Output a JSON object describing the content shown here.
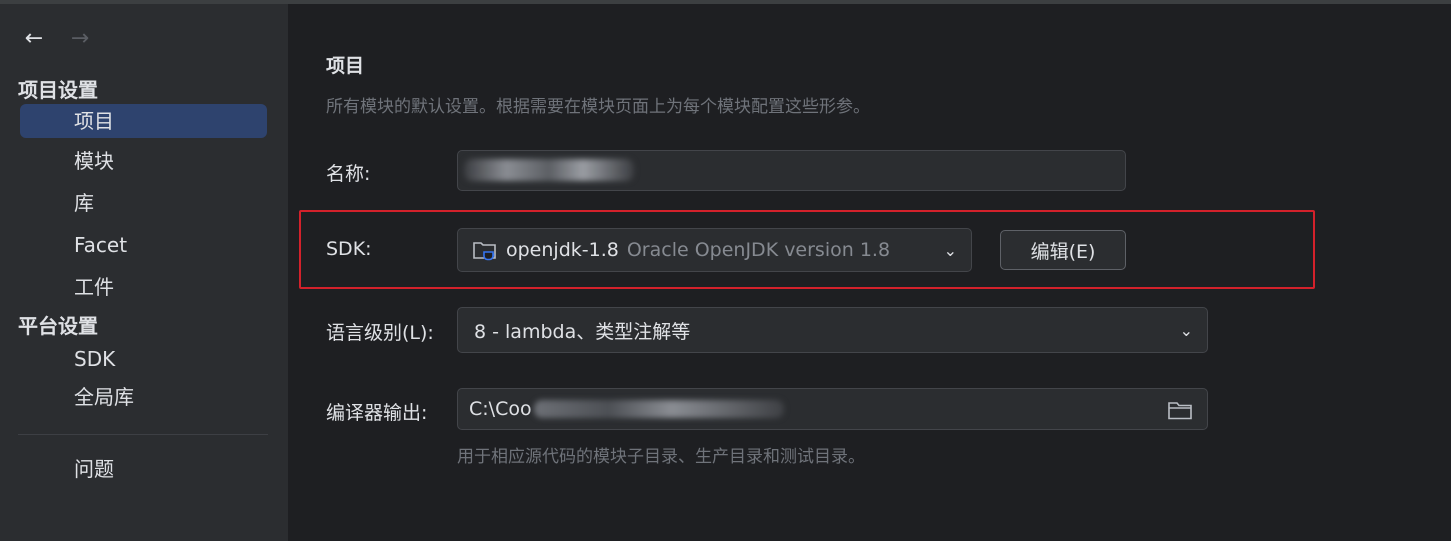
{
  "sidebar": {
    "nav": {
      "back_icon": "←",
      "forward_icon": "→"
    },
    "section_project_settings": "项目设置",
    "project_items": [
      "项目",
      "模块",
      "库",
      "Facet",
      "工件"
    ],
    "section_platform_settings": "平台设置",
    "platform_items": [
      "SDK",
      "全局库"
    ],
    "problems": "问题",
    "selected_item": "项目"
  },
  "main": {
    "title": "项目",
    "description": "所有模块的默认设置。根据需要在模块页面上为每个模块配置这些形参。",
    "name_label": "名称:",
    "sdk_label": "SDK:",
    "sdk_name": "openjdk-1.8",
    "sdk_detail": "Oracle OpenJDK version 1.8",
    "edit_button": "编辑(E)",
    "language_label": "语言级别(L):",
    "language_value": "8 - lambda、类型注解等",
    "compiler_label": "编译器输出:",
    "compiler_value_prefix": "C:\\Coo",
    "compiler_hint": "用于相应源代码的模块子目录、生产目录和测试目录。"
  },
  "colors": {
    "selected_bg": "#2e436e",
    "highlight_border": "#d3212b",
    "accent_icon": "#3574f0"
  }
}
